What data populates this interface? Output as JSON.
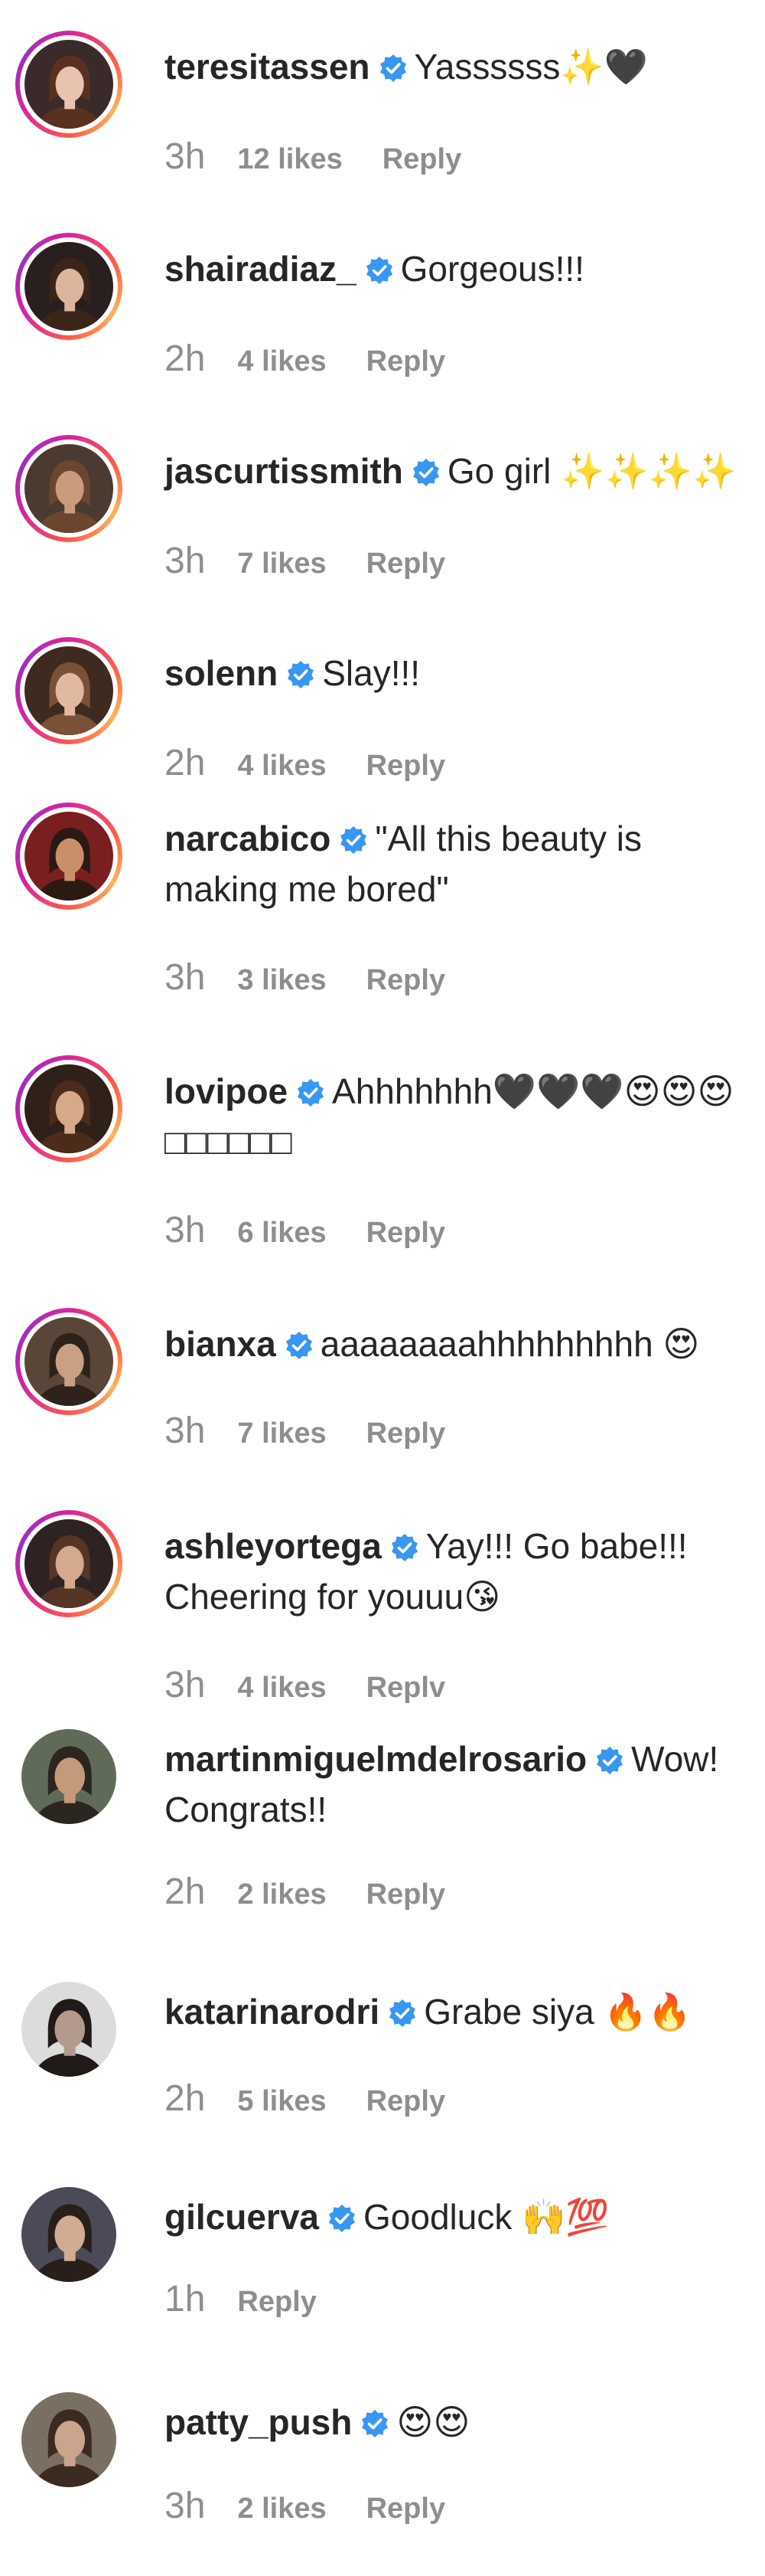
{
  "comments": [
    {
      "username": "teresitassen",
      "text": "Yassssss✨🖤",
      "time": "3h",
      "likes": "12 likes",
      "reply": "Reply",
      "ring": true
    },
    {
      "username": "shairadiaz_",
      "text": "Gorgeous!!!",
      "time": "2h",
      "likes": "4 likes",
      "reply": "Reply",
      "ring": true
    },
    {
      "username": "jascurtissmith",
      "text": "Go girl ✨✨✨✨",
      "time": "3h",
      "likes": "7 likes",
      "reply": "Reply",
      "ring": true
    },
    {
      "username": "solenn",
      "text": "Slay!!!",
      "time": "2h",
      "likes": "4 likes",
      "reply": "Reply",
      "ring": true
    },
    {
      "username": "narcabico",
      "text": "\"All this beauty is making me bored\"",
      "time": "3h",
      "likes": "3 likes",
      "reply": "Reply",
      "ring": true
    },
    {
      "username": "lovipoe",
      "text": "Ahhhhhhh🖤🖤🖤😍😍😍□□□□□□",
      "time": "3h",
      "likes": "6 likes",
      "reply": "Reply",
      "ring": true
    },
    {
      "username": "bianxa",
      "text": "aaaaaaaahhhhhhhhh 😍",
      "time": "3h",
      "likes": "7 likes",
      "reply": "Reply",
      "ring": true
    },
    {
      "username": "ashleyortega",
      "text": "Yay!!! Go babe!!! Cheering for youuu😘",
      "time": "3h",
      "likes": "4 likes",
      "reply": "Replv",
      "ring": true
    },
    {
      "username": "martinmiguelmdelrosario",
      "text": "Wow! Congrats!!",
      "time": "2h",
      "likes": "2 likes",
      "reply": "Reply",
      "ring": false
    },
    {
      "username": "katarinarodri",
      "text": "Grabe siya 🔥🔥",
      "time": "2h",
      "likes": "5 likes",
      "reply": "Reply",
      "ring": false
    },
    {
      "username": "gilcuerva",
      "text": "Goodluck 🙌💯",
      "time": "1h",
      "likes": "",
      "reply": "Reply",
      "ring": false
    },
    {
      "username": "patty_push",
      "text": "😍😍",
      "time": "3h",
      "likes": "2 likes",
      "reply": "Reply",
      "ring": false
    }
  ],
  "colors": {
    "verified_badge": "#3897f0",
    "username": "#262626",
    "meta": "#8e8e8e",
    "story_ring_start": "#d6249f",
    "story_ring_end": "#fdb45a"
  },
  "icons": {
    "verified": "verified-badge-icon",
    "avatar": "profile-avatar"
  }
}
